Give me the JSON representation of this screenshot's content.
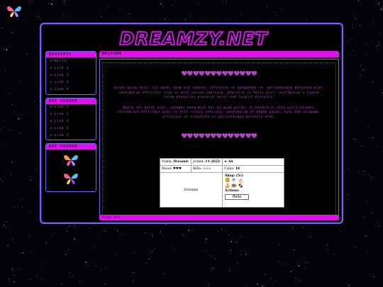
{
  "site": {
    "title": "DREAMZY.NET"
  },
  "sidebar": {
    "navigate_header": "NAVIGATE",
    "nav_links": [
      "Hello",
      "Link 1",
      "Link 2",
      "Link 3",
      "Link 4"
    ],
    "second_header": "ABC HEADER",
    "second_links": [
      "Link 1",
      "Link 2",
      "Link 3",
      "Link 4",
      "Link 5"
    ],
    "third_header": "ABC HEADER"
  },
  "main": {
    "header": "WELCOME",
    "hearts": "💜💜💜💜💜💜💜💜💜💜💜💜💜",
    "paragraph1": "Lorem ipsum dolor sit amet, diam est sapien, ultricies ut vulputate in, pellentesque molestie erat. vestibulum efficitur sine in elit cursus vehicula. pharetra in felis nisl. vestibulum a fugiat lorem phasellus placerat velit sed feugiat pharetra.",
    "paragraph2": "Nulla vel dolor erat. integer hendrerit dui at quam porta, in hendrerit elit sollicitudin. vestibulum efficitur quis in elit cursus vehicula. vestibulum at magna purus. nunc est aliquam, ultricies ut vulputate in pellentesque molestie erat.",
    "footer": "footer text"
  },
  "profile": {
    "name_label": "Name:",
    "name_value": "Dreamie",
    "joined_label": "Joined:",
    "joined_value": "11-2022",
    "sign_value": "Air",
    "mood_label": "Mood:",
    "mood_value": "♥♥♥",
    "bells_label": "Bells:",
    "bells_value": "∞∞∞",
    "coins_label": "Coins:",
    "coins_value": "18",
    "avatar_name": "Dreamie",
    "shop_label": "Shop: (5c)",
    "shop_row1": "🍔 ☕ 🎂",
    "shop_row2": "🍰 🍩 🍫",
    "actions_label": "Actions:",
    "action_button": "Hello"
  }
}
